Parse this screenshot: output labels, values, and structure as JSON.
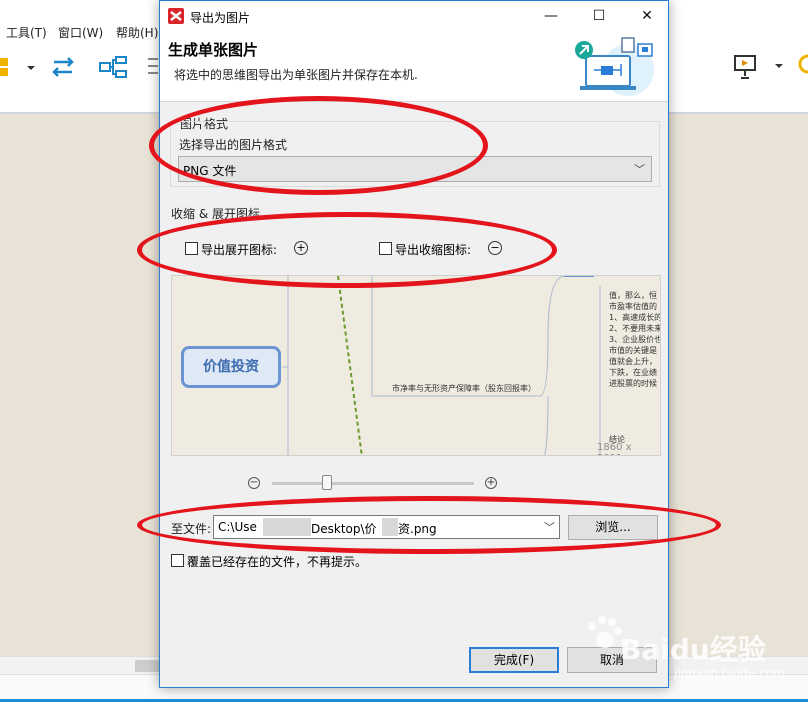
{
  "app": {
    "menu": [
      "工具(T)",
      "窗口(W)",
      "帮助(H)"
    ]
  },
  "dialog": {
    "title": "导出为图片",
    "heading": "生成单张图片",
    "description": "将选中的思维图导出为单张图片并保存在本机.",
    "format_section": {
      "label": "图片格式",
      "prompt": "选择导出的图片格式",
      "selected": "PNG 文件"
    },
    "expand_section": {
      "label": "收缩 & 展开图标",
      "export_expand_label": "导出展开图标:",
      "export_collapse_label": "导出收缩图标:",
      "expand_checked": false,
      "collapse_checked": false
    },
    "preview": {
      "central_node": "价值投资",
      "branch_label": "市净率与无形资产保障率（股东回报率）",
      "note": "值，那么，恒\n市盈率估值的\n1、高速成长的\n2、不要用未来\n3、企业股价也\n市值的关键是\n值就会上升，\n下跌，在业绩\n进股票的时候",
      "tail_label": "结论",
      "size": "1860 x 2011"
    },
    "file": {
      "label": "至文件:",
      "path_start": "C:\\Use",
      "path_mid": "Desktop\\价",
      "path_end": "资.png",
      "browse_button": "浏览..."
    },
    "overwrite_label": "覆盖已经存在的文件，不再提示。",
    "finish_button": "完成(F)",
    "cancel_button": "取消"
  },
  "watermark": {
    "main": "Baidu经验",
    "sub": "jingyan.baidu.com"
  },
  "colors": {
    "accent": "#2a7dd6",
    "annotation": "#e3141b",
    "node_border": "#6a95d2"
  }
}
